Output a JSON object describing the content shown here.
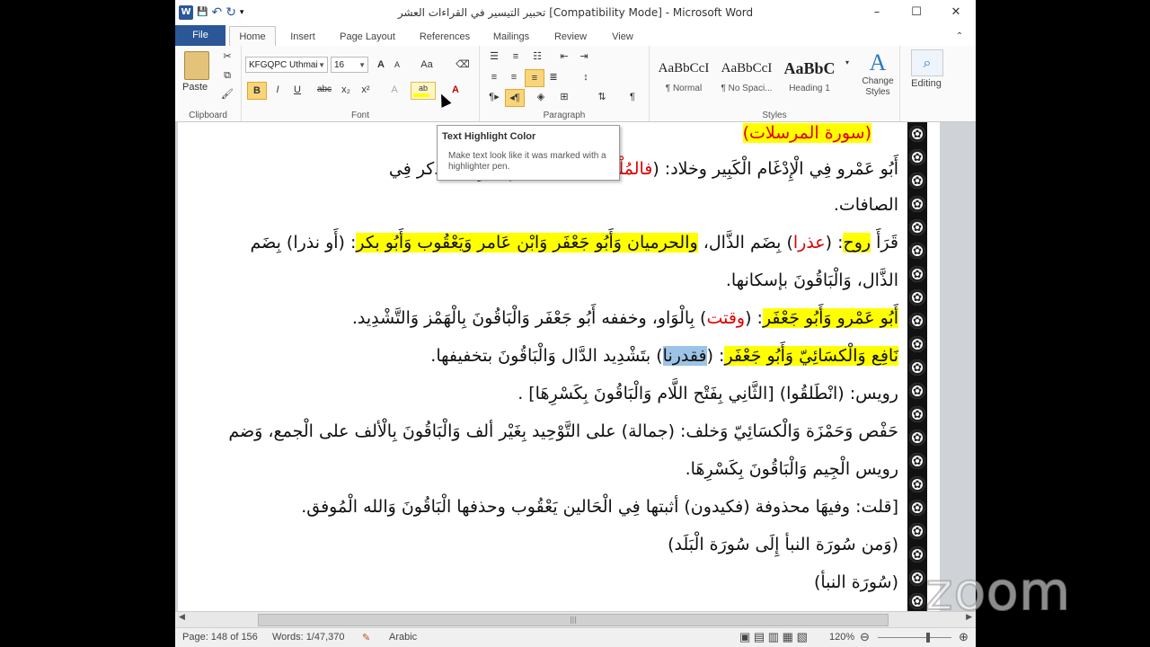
{
  "window": {
    "title": "تحبير التيسير في القراءات العشر [Compatibility Mode] - Microsoft Word",
    "minimize": "–",
    "maximize": "☐",
    "close": "✕"
  },
  "qat": {
    "app_icon": "W",
    "save": "💾",
    "undo": "↶",
    "redo": "↻",
    "more": "▾"
  },
  "tabs": [
    {
      "label": "File"
    },
    {
      "label": "Home"
    },
    {
      "label": "Insert"
    },
    {
      "label": "Page Layout"
    },
    {
      "label": "References"
    },
    {
      "label": "Mailings"
    },
    {
      "label": "Review"
    },
    {
      "label": "View"
    }
  ],
  "ribbon": {
    "clipboard": {
      "label": "Clipboard",
      "paste": "Paste"
    },
    "font": {
      "label": "Font",
      "font_name": "KFGQPC Uthmai",
      "font_size": "16",
      "bold": "B",
      "italic": "I",
      "underline": "U",
      "strike": "abc",
      "subscript": "x₂",
      "superscript": "x²",
      "grow": "A",
      "shrink": "A",
      "case": "Aa"
    },
    "paragraph": {
      "label": "Paragraph"
    },
    "styles": {
      "label": "Styles",
      "items": [
        {
          "sample": "AaBbCcI",
          "name": "¶ Normal"
        },
        {
          "sample": "AaBbCcI",
          "name": "¶ No Spaci..."
        },
        {
          "sample": "AaBbC",
          "name": "Heading 1"
        }
      ],
      "change_styles": "Change Styles"
    },
    "editing": {
      "label": "Editing"
    }
  },
  "tooltip": {
    "title": "Text Highlight Color",
    "description": "Make text look like it was marked with a highlighter pen."
  },
  "document": {
    "line0": "(سورة المرسلات)",
    "line1_a": "أَبُو عَمْرو فِي الْإِدْغَام الْكَبِير وخلاد: (",
    "line1_b": "فالمُلْقِيَات صبحا",
    "line1_c": ") بِالْإِدْغَامِ وَقد ذكر فِي",
    "line2": "الصافات.",
    "line3_a": "قَرَأَ ",
    "line3_b": "روح",
    "line3_c": ": (",
    "line3_d": "عذرا",
    "line3_e": ") بِضَم الذَّال، ",
    "line3_f": "والحرميان وَأَبُو جَعْفَر وَابْن عَامر وَيَعْقُوب وَأَبُو بكر",
    "line3_g": ": (أَو نذرا) بِضَم",
    "line4": "الذَّال، وَالْبَاقُونَ بإسكانها.",
    "line5_a": "أَبُو عَمْرو وَأَبُو جَعْفَر",
    "line5_b": ": (",
    "line5_c": "وقتت",
    "line5_d": ") بِالْوَاو، وخففه أَبُو جَعْفَر وَالْبَاقُونَ بِالْهَمْز وَالتَّشْدِيد.",
    "line6_a": "نَافِع وَالْكسَائِيّ وَأَبُو جَعْفَر",
    "line6_b": ": (",
    "line6_c": "فقدرنا",
    "line6_d": ") بتَشْدِيد الدَّال وَالْبَاقُونَ بتخفيفها.",
    "line7": "رويس: (انْطَلقُوا) [الثَّانِي بِفَتْح اللَّام وَالْبَاقُونَ بِكَسْرِهَا] .",
    "line8": "حَفْص وَحَمْزَة وَالْكسَائِيّ وَخلف: (جمالة) على التَّوْحِيد بِغَيْر ألف وَالْبَاقُونَ بِالْألف على الْجمع، وَضم",
    "line9": "رويس الْجِيم وَالْبَاقُونَ بِكَسْرِهَا.",
    "line10": "[قلت: وفيهَا محذوفة (فكيدون) أثبتها فِي الْحَالين يَعْقُوب وحذفها الْبَاقُونَ وَالله الْمُوفق.",
    "line11": "(وَمن سُورَة النبأ إِلَى سُورَة الْبَلَد)",
    "line12": "(سُورَة النبأ)"
  },
  "status": {
    "page": "Page: 148 of 156",
    "words": "Words: 1/47,370",
    "language": "Arabic",
    "zoom": "120%",
    "zoom_out": "⊖",
    "zoom_in": "⊕"
  },
  "watermark": "zoom",
  "colors": {
    "highlight": "#ffff00",
    "red_text": "#e00000",
    "selection": "#9dc3e6",
    "file_tab": "#2b5797"
  }
}
